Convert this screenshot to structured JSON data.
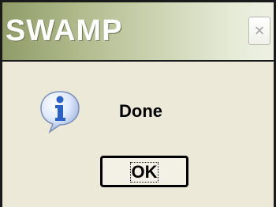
{
  "window": {
    "title": "SWAMP",
    "close_glyph": "×"
  },
  "dialog": {
    "icon": "info-icon",
    "message": "Done",
    "ok_label": "OK"
  },
  "colors": {
    "titlebar_start": "#8f9c68",
    "titlebar_end": "#eef1e2",
    "dialog_background": "#ece9d8",
    "icon_blue": "#2a62c9"
  }
}
